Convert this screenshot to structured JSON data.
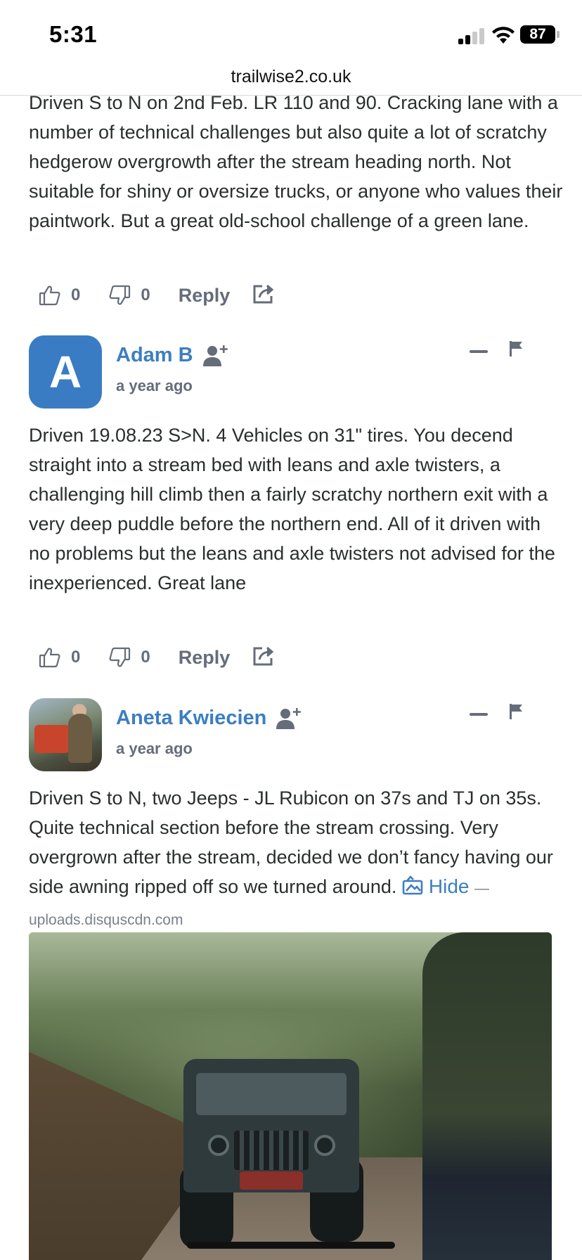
{
  "status_bar": {
    "time": "5:31",
    "battery": "87"
  },
  "browser": {
    "url": "trailwise2.co.uk"
  },
  "comments": [
    {
      "text": "Driven S to N on 2nd Feb. LR 110 and 90. Cracking lane with a number of technical challenges but also quite a lot of scratchy hedgerow overgrowth after the stream heading north. Not suitable for shiny or oversize trucks, or anyone who values their paintwork. But a great old-school challenge of a green lane.",
      "upvotes": "0",
      "downvotes": "0",
      "reply_label": "Reply"
    },
    {
      "author": "Adam B",
      "avatar_letter": "A",
      "timestamp": "a year ago",
      "text": "Driven 19.08.23 S>N. 4 Vehicles on 31\" tires. You decend straight into a stream bed with leans and axle twisters, a challenging hill climb then a fairly scratchy northern exit with a very deep puddle before the northern end. All of it driven with no problems but the leans and axle twisters not advised for the inexperienced. Great lane",
      "upvotes": "0",
      "downvotes": "0",
      "reply_label": "Reply"
    },
    {
      "author": "Aneta Kwiecien",
      "timestamp": "a year ago",
      "text": "Driven S to N, two Jeeps - JL Rubicon on 37s and TJ on 35s. Quite technical section before the stream crossing. Very overgrown after the stream, decided we don’t fancy having our side awning ripped off so we turned around.",
      "media_toggle": "Hide",
      "media_source": "— uploads.disquscdn.com"
    }
  ],
  "colors": {
    "link": "#3c7ec1",
    "muted": "#656c7a",
    "text": "#2a2e2e"
  }
}
